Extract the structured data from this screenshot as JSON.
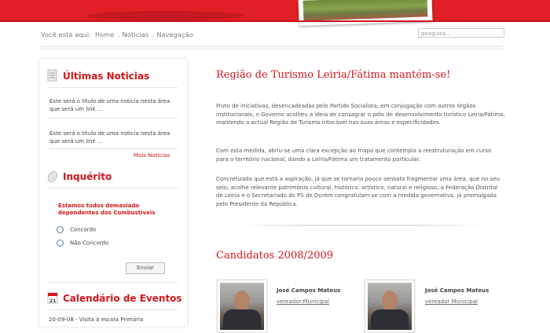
{
  "breadcrumb": {
    "prefix": "Você está aqui:",
    "home": "Home",
    "sep1": ". Noticias",
    "sep2": ". Navegação"
  },
  "search": {
    "placeholder": "pesquisa..."
  },
  "sidebar": {
    "news_title": "Últimas Noticias",
    "news_items": [
      "Este será o título de uma noticia nesta área que será um link ...",
      "Este será o título de uma noticia nesta área que será um link ..."
    ],
    "more_news": "Mais Noticias",
    "poll_title": "Inquérito",
    "poll_question": "Estamos todos demasiado dependentes dos Combustiveis",
    "poll_options": [
      "Concordo",
      "Não Concordo"
    ],
    "poll_button": "Enviar",
    "calendar_title": "Calendário de Eventos",
    "calendar_day": "21",
    "calendar_item": "20-09-08 - Visita à escola Primária"
  },
  "main": {
    "article_title": "Região de Turismo Leiria/Fátima mantém-se!",
    "paragraphs": [
      " Fruto de iniciativas, desencadeadas pelo Partido Socialista, em conjugação com outros órgãos institucionais, o Governo acolheu a ideia de consagrar o pólo de desenvolvimento turístico Leiria/Fátima, mantendo a actual Região de Turismo intocável nas suas áreas e especificidades.",
      "Com esta medida, abriu-se uma clara excepção ao mapa que contempla a reestruturação em curso para o território nacional, dando a Leiria/Fátima um tratamento particular.",
      "Concretizada que está a aspiração, já que se tornaria pouco sensato fragmentar uma área, que no seu seio, acolhe relevante património cultural, histórico, artístico, natural e religioso, a Federação Distrital de Leiria e o Secretariado do PS de Ourém congratulam-se com a medida governativa, já promulgada pelo Presidente da República."
    ],
    "candidates_title": "Candidatos 2008/2009",
    "candidates": [
      {
        "name": "José Campos Mateus",
        "role": "vereador Municipal"
      },
      {
        "name": "José Campos Mateus",
        "role": "vereador Municipal"
      }
    ]
  }
}
